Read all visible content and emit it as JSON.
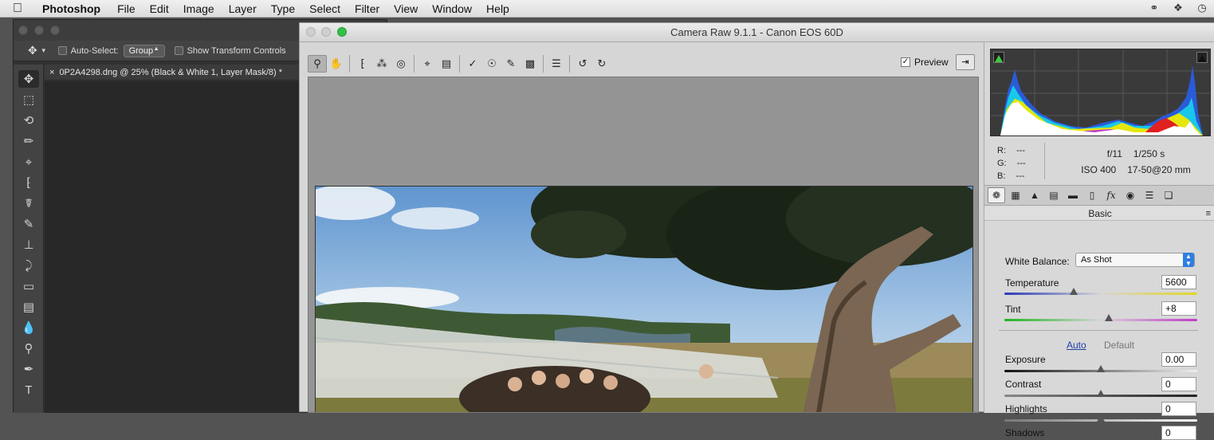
{
  "menubar": {
    "items": [
      "Photoshop",
      "File",
      "Edit",
      "Image",
      "Layer",
      "Type",
      "Select",
      "Filter",
      "View",
      "Window",
      "Help"
    ]
  },
  "photoshop": {
    "options": {
      "auto_select_label": "Auto-Select:",
      "auto_select_value": "Group",
      "show_transform_label": "Show Transform Controls"
    },
    "document_tab": "0P2A4298.dng @ 25% (Black & White 1, Layer Mask/8) *"
  },
  "camera_raw": {
    "title": "Camera Raw 9.1.1  -  Canon EOS 60D",
    "preview_label": "Preview",
    "rgb": {
      "r_label": "R:",
      "r_value": "---",
      "g_label": "G:",
      "g_value": "---",
      "b_label": "B:",
      "b_value": "---"
    },
    "exif": {
      "aperture": "f/11",
      "shutter": "1/250 s",
      "iso": "ISO 400",
      "lens": "17-50@20 mm"
    },
    "panel_title": "Basic",
    "white_balance_label": "White Balance:",
    "white_balance_value": "As Shot",
    "temperature_label": "Temperature",
    "temperature_value": "5600",
    "tint_label": "Tint",
    "tint_value": "+8",
    "auto_label": "Auto",
    "default_label": "Default",
    "exposure_label": "Exposure",
    "exposure_value": "0.00",
    "contrast_label": "Contrast",
    "contrast_value": "0",
    "highlights_label": "Highlights",
    "highlights_value": "0",
    "shadows_label": "Shadows",
    "shadows_value": "0",
    "sliders": {
      "temperature": 0.36,
      "tint": 0.54,
      "exposure": 0.5,
      "contrast": 0.5,
      "highlights": 0.5
    }
  }
}
